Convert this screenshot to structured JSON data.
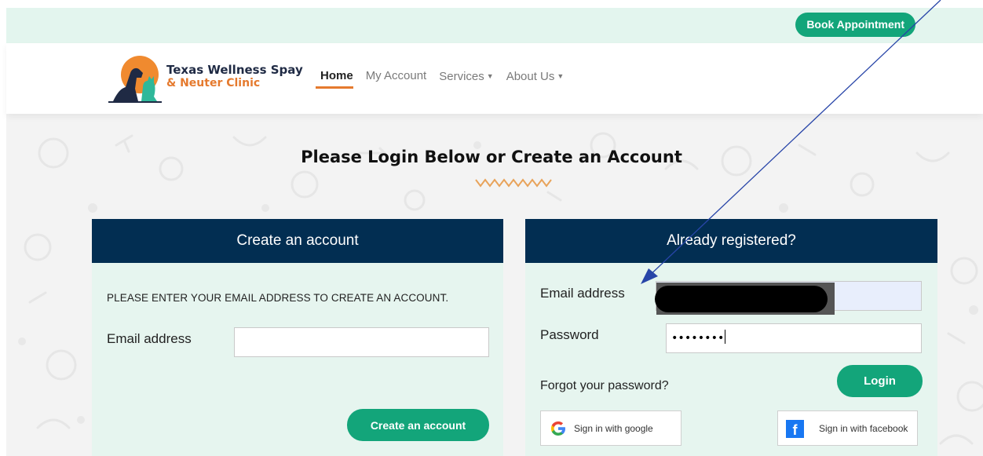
{
  "topbar": {
    "book_label": "Book Appointment"
  },
  "brand": {
    "line1": "Texas Wellness Spay",
    "line2": "& Neuter Clinic"
  },
  "nav": {
    "items": [
      {
        "label": "Home"
      },
      {
        "label": "My Account"
      },
      {
        "label": "Services"
      },
      {
        "label": "About Us"
      }
    ],
    "dropdown_caret": "▼"
  },
  "page": {
    "title": "Please Login Below or Create an Account"
  },
  "create": {
    "header": "Create an account",
    "instruction": "PLEASE ENTER YOUR EMAIL ADDRESS TO CREATE AN ACCOUNT.",
    "email_label": "Email address",
    "email_value": "",
    "button": "Create an account"
  },
  "login": {
    "header": "Already registered?",
    "email_label": "Email address",
    "email_value": "",
    "password_label": "Password",
    "password_value": "••••••••",
    "forgot": "Forgot your password?",
    "button": "Login",
    "google": "Sign in with google",
    "facebook": "Sign in with facebook"
  },
  "colors": {
    "green": "#13a57a",
    "navy": "#022e52",
    "orange": "#e57a2e",
    "panel_bg": "#e6f5ef",
    "arrow": "#2845a8"
  },
  "icons": {
    "logo": "dog-cat-logo",
    "google": "google-g-icon",
    "facebook": "facebook-f-icon"
  }
}
